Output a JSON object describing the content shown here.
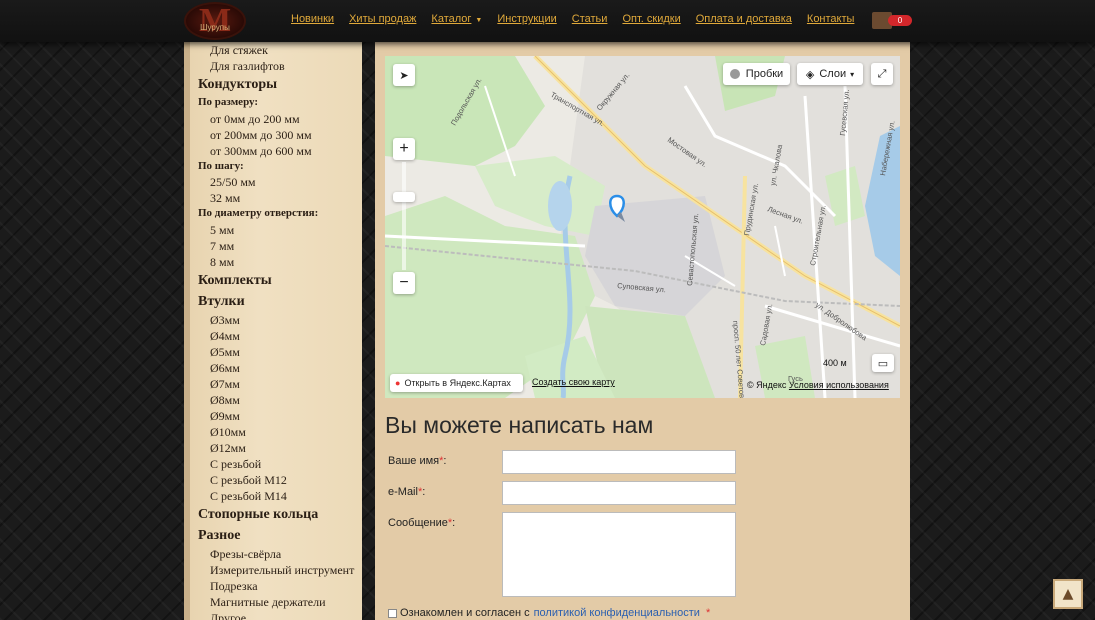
{
  "header": {
    "logo_text": "M",
    "logo_subtext": "Шурупы",
    "nav": [
      {
        "label": "Новинки"
      },
      {
        "label": "Хиты продаж"
      },
      {
        "label": "Каталог",
        "caret": "▼"
      },
      {
        "label": "Инструкции"
      },
      {
        "label": "Статьи"
      },
      {
        "label": "Опт. скидки"
      },
      {
        "label": "Оплата и доставка"
      },
      {
        "label": "Контакты"
      }
    ],
    "cart_count": "0"
  },
  "sidebar": {
    "items": [
      {
        "type": "sub",
        "label": "Для стяжек"
      },
      {
        "type": "sub",
        "label": "Для газлифтов"
      },
      {
        "type": "cat",
        "label": "Кондукторы"
      },
      {
        "type": "grp",
        "label": "По размеру:"
      },
      {
        "type": "sub",
        "label": "от 0мм до 200 мм"
      },
      {
        "type": "sub",
        "label": "от 200мм до 300 мм"
      },
      {
        "type": "sub",
        "label": "от 300мм до 600 мм"
      },
      {
        "type": "grp",
        "label": "По шагу:"
      },
      {
        "type": "sub",
        "label": "25/50 мм"
      },
      {
        "type": "sub",
        "label": "32 мм"
      },
      {
        "type": "grp",
        "label": "По диаметру отверстия:"
      },
      {
        "type": "sub",
        "label": "5 мм"
      },
      {
        "type": "sub",
        "label": "7 мм"
      },
      {
        "type": "sub",
        "label": "8 мм"
      },
      {
        "type": "cat",
        "label": "Комплекты"
      },
      {
        "type": "cat",
        "label": "Втулки"
      },
      {
        "type": "sub",
        "label": "Ø3мм"
      },
      {
        "type": "sub",
        "label": "Ø4мм"
      },
      {
        "type": "sub",
        "label": "Ø5мм"
      },
      {
        "type": "sub",
        "label": "Ø6мм"
      },
      {
        "type": "sub",
        "label": "Ø7мм"
      },
      {
        "type": "sub",
        "label": "Ø8мм"
      },
      {
        "type": "sub",
        "label": "Ø9мм"
      },
      {
        "type": "sub",
        "label": "Ø10мм"
      },
      {
        "type": "sub",
        "label": "Ø12мм"
      },
      {
        "type": "sub",
        "label": "С резьбой"
      },
      {
        "type": "sub",
        "label": "С резьбой M12"
      },
      {
        "type": "sub",
        "label": "С резьбой M14"
      },
      {
        "type": "cat",
        "label": "Стопорные кольца"
      },
      {
        "type": "cat",
        "label": "Разное"
      },
      {
        "type": "sub",
        "label": "Фрезы-свёрла"
      },
      {
        "type": "sub",
        "label": "Измерительный инструмент"
      },
      {
        "type": "sub",
        "label": "Подрезка"
      },
      {
        "type": "sub",
        "label": "Магнитные держатели"
      },
      {
        "type": "sub",
        "label": "Другое"
      }
    ]
  },
  "map": {
    "traffic_label": "Пробки",
    "layers_label": "Слои",
    "open_link": "Открыть в Яндекс.Картах",
    "create_link": "Создать свою карту",
    "scale_label": "400 м",
    "copyright": "© Яндекс",
    "terms": "Условия использования",
    "streets": [
      "Транспортная ул.",
      "Окружная ул.",
      "Подольская ул.",
      "Суповская ул.",
      "ул. Добролюбова",
      "Лесная ул.",
      "Мостовая ул.",
      "Садовая ул.",
      "Строительная ул.",
      "Набережная ул.",
      "ул. Чкалова",
      "Прудинская ул.",
      "Гусевская ул.",
      "просп. 50 лет Советов",
      "Севастопольская ул.",
      "Гусь"
    ]
  },
  "form": {
    "title": "Вы можете написать нам",
    "name_label": "Ваше имя",
    "email_label": "e-Mail",
    "message_label": "Сообщение",
    "required_mark": "*",
    "consent_text": "Ознакомлен и согласен с",
    "consent_link": "политикой конфиденциальности",
    "name_value": "",
    "email_value": "",
    "message_value": ""
  },
  "scroll_top_icon": "▲",
  "colors": {
    "nav_link": "#e0a93a",
    "cart_badge": "#d3272b",
    "link_blue": "#2a5fb0"
  }
}
